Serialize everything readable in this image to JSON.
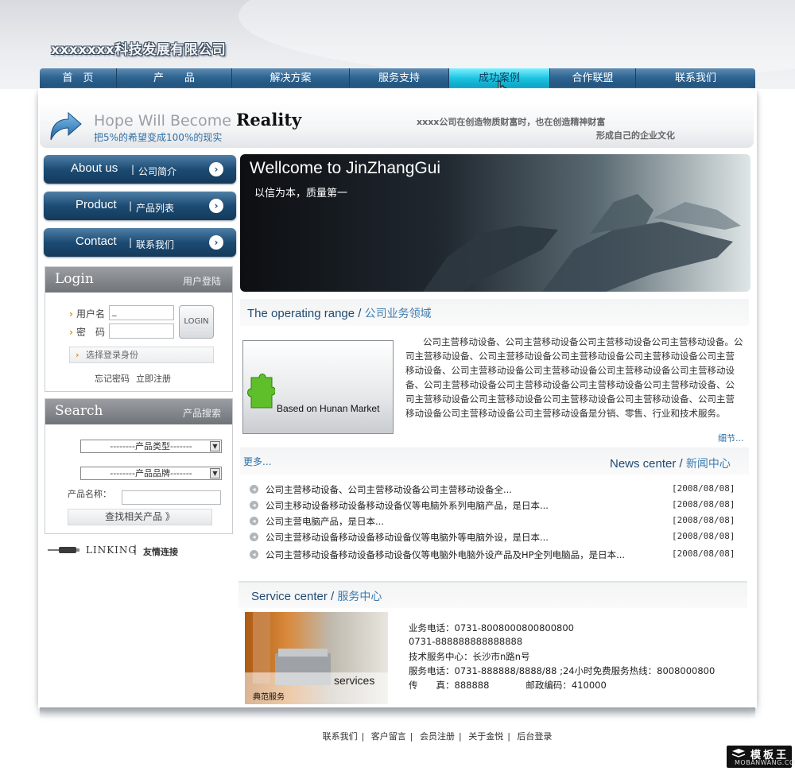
{
  "header": {
    "company_name": "xxxxxxx科技发展有限公司"
  },
  "nav": {
    "items": [
      {
        "label": "首　页"
      },
      {
        "label": "产　　品"
      },
      {
        "label": "解决方案"
      },
      {
        "label": "服务支持"
      },
      {
        "label": "成功案例"
      },
      {
        "label": "合作联盟"
      },
      {
        "label": "联系我们"
      }
    ],
    "active_index": 4
  },
  "banner": {
    "slogan_en_light": "Hope Will Become",
    "slogan_en_bold": "Reality",
    "slogan_cn": "把5%的希望变成100%的现实",
    "motto_line1": "xxxx公司在创造物质财富时，也在创造精神财富",
    "motto_line2": "形成自己的企业文化"
  },
  "sidebar": {
    "buttons": [
      {
        "en": "About us",
        "cn": "公司简介"
      },
      {
        "en": "Product",
        "cn": "产品列表"
      },
      {
        "en": "Contact",
        "cn": "联系我们"
      }
    ]
  },
  "login": {
    "title": "Login",
    "subtitle": "用户登陆",
    "username_label": "用户名",
    "username_value": "_",
    "password_label": "密　码",
    "button_label": "LOGIN",
    "identity_label": "选择登录身份",
    "forgot_label": "忘记密码",
    "register_label": "立即注册"
  },
  "search": {
    "title": "Search",
    "subtitle": "产品搜索",
    "type_select": "--------产品类型-------",
    "brand_select": "--------产品品牌-------",
    "name_label": "产品名称：",
    "button_label": "查找相关产品 》"
  },
  "linking": {
    "en": "LINKING",
    "cn": "友情连接"
  },
  "hero": {
    "title": "Wellcome to JinZhangGui",
    "subtitle": "以信为本，质量第一"
  },
  "operating": {
    "title_en": "The operating range",
    "title_cn": "公司业务领域",
    "thumb_caption": "Based on Hunan Market",
    "description": "公司主营移动设备、公司主营移动设备公司主营移动设备公司主营移动设备。公司主营移动设备、公司主营移动设备公司主营移动设备公司主营移动设备公司主营移动设备、公司主营移动设备公司主营移动设备公司主营移动设备公司主营移动设备、公司主营移动设备公司主营移动设备公司主营移动设备公司主营移动设备、公司主营移动设备公司主营移动设备公司主营移动设备公司主营移动设备、公司主营移动设备公司主营移动设备公司主营移动设备是分销、零售、行业和技术服务。",
    "more_label": "细节..."
  },
  "news": {
    "more_label": "更多...",
    "title_en": "News center",
    "title_cn": "新闻中心",
    "items": [
      {
        "title": "公司主营移动设备、公司主营移动设备公司主营移动设备全...",
        "date": "[2008/08/08]"
      },
      {
        "title": "公司主移动设备移动设备移动设备仪等电脑外系列电脑产品，是日本...",
        "date": "[2008/08/08]"
      },
      {
        "title": "公司主营电脑产品，是日本...",
        "date": "[2008/08/08]"
      },
      {
        "title": "公司主营移动设备移动设备移动设备仪等电脑外等电脑外设，是日本...",
        "date": "[2008/08/08]"
      },
      {
        "title": "公司主营移动设备移动设备移动设备仪等电脑外电脑外设产品及HP全列电脑品，是日本...",
        "date": "[2008/08/08]"
      }
    ]
  },
  "service": {
    "title_en": "Service center",
    "title_cn": "服务中心",
    "photo_word": "services",
    "photo_caption": "典范服务",
    "lines": [
      "业务电话：0731-8008000800800800",
      "0731-888888888888888",
      "技术服务中心：长沙市n路n号",
      "服务电话：0731-888888/8888/88 ;24小时免费服务热线：8008000800",
      "传　　真：888888　　　　邮政编码：410000"
    ]
  },
  "footer": {
    "links": [
      "联系我们",
      "客户留言",
      "会员注册",
      "关于金悦",
      "后台登录"
    ]
  },
  "watermark": {
    "line1": "模板王",
    "line2": "MOBANWANG.COM"
  }
}
